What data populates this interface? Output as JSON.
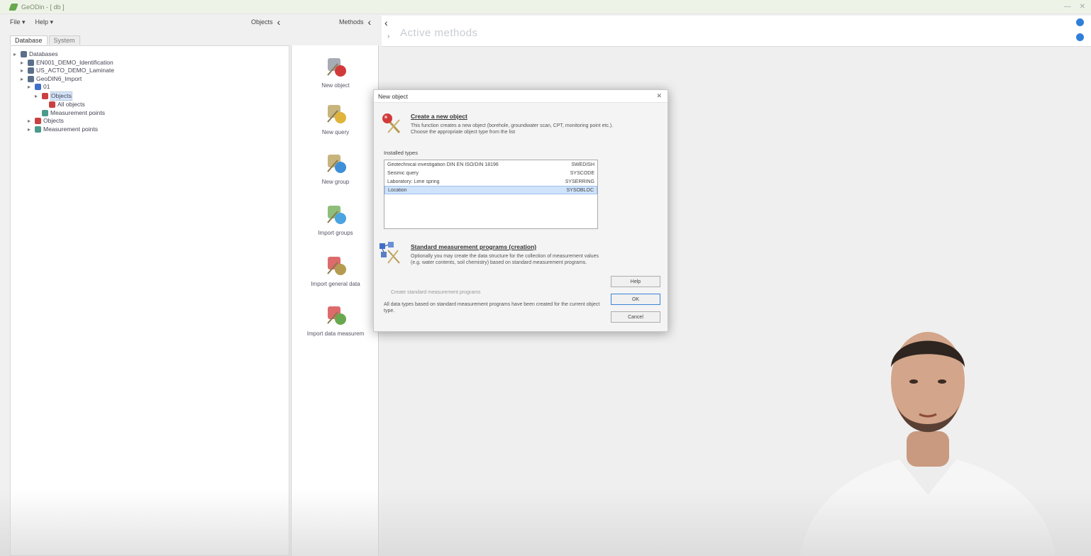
{
  "window": {
    "title": "GeODin - [ db ]"
  },
  "menu": {
    "file": "File ▾",
    "help": "Help ▾"
  },
  "panels": {
    "objects_label": "Objects",
    "methods_label": "Methods"
  },
  "tabs": [
    {
      "label": "Database"
    },
    {
      "label": "System"
    }
  ],
  "tree": [
    {
      "label": "Databases",
      "level": 0,
      "icon": "database-icon"
    },
    {
      "label": "EN001_DEMO_Identification",
      "level": 1,
      "icon": "database-icon"
    },
    {
      "label": "US_ACTO_DEMO_Laminate",
      "level": 1,
      "icon": "database-icon"
    },
    {
      "label": "GeoDIN6_Import",
      "level": 1,
      "icon": "database-icon"
    },
    {
      "label": "01",
      "level": 2,
      "icon": "group-icon"
    },
    {
      "label": "Objects",
      "level": 3,
      "icon": "objects-icon",
      "selected": true
    },
    {
      "label": "All objects",
      "level": 4,
      "icon": "objects-icon"
    },
    {
      "label": "Measurement points",
      "level": 3,
      "icon": "measurement-icon"
    },
    {
      "label": "Objects",
      "level": 2,
      "icon": "objects-icon"
    },
    {
      "label": "Measurement points",
      "level": 2,
      "icon": "measurement-icon"
    }
  ],
  "methods": [
    {
      "label": "New object"
    },
    {
      "label": "New query"
    },
    {
      "label": "New group"
    },
    {
      "label": "Import groups"
    },
    {
      "label": "Import general data"
    },
    {
      "label": "Import data measurem"
    }
  ],
  "right": {
    "title": "Active methods"
  },
  "dialog": {
    "title": "New object",
    "close": "✕",
    "section1": {
      "heading": "Create a new object",
      "text": "This function creates a new object (borehole, groundwater scan, CPT, monitoring point etc.). Choose the appropriate object type from the list"
    },
    "types_label": "Installed types",
    "types": [
      {
        "name": "Geotechnical investigation DIN EN ISO/DIN 18196",
        "code": "SWEDISH"
      },
      {
        "name": "Seismic query",
        "code": "SYSCODE"
      },
      {
        "name": "Laboratory: Lime spring",
        "code": "SYSERRING"
      },
      {
        "name": "Location",
        "code": "SYSOBLOC",
        "selected": true
      }
    ],
    "section2": {
      "heading": "Standard measurement programs (creation)",
      "text": "Optionally you may create the data structure for the collection of measurement values (e.g. water contents, soil chemistry) based on standard measurement programs."
    },
    "checkbox": "Create standard measurement programs",
    "info": "All data types based on standard measurement programs have been created for the current object type.",
    "buttons": {
      "help": "Help",
      "ok": "OK",
      "cancel": "Cancel"
    }
  },
  "colors": {
    "accent": "#2f7fd8",
    "selection": "#cfe3fb"
  }
}
